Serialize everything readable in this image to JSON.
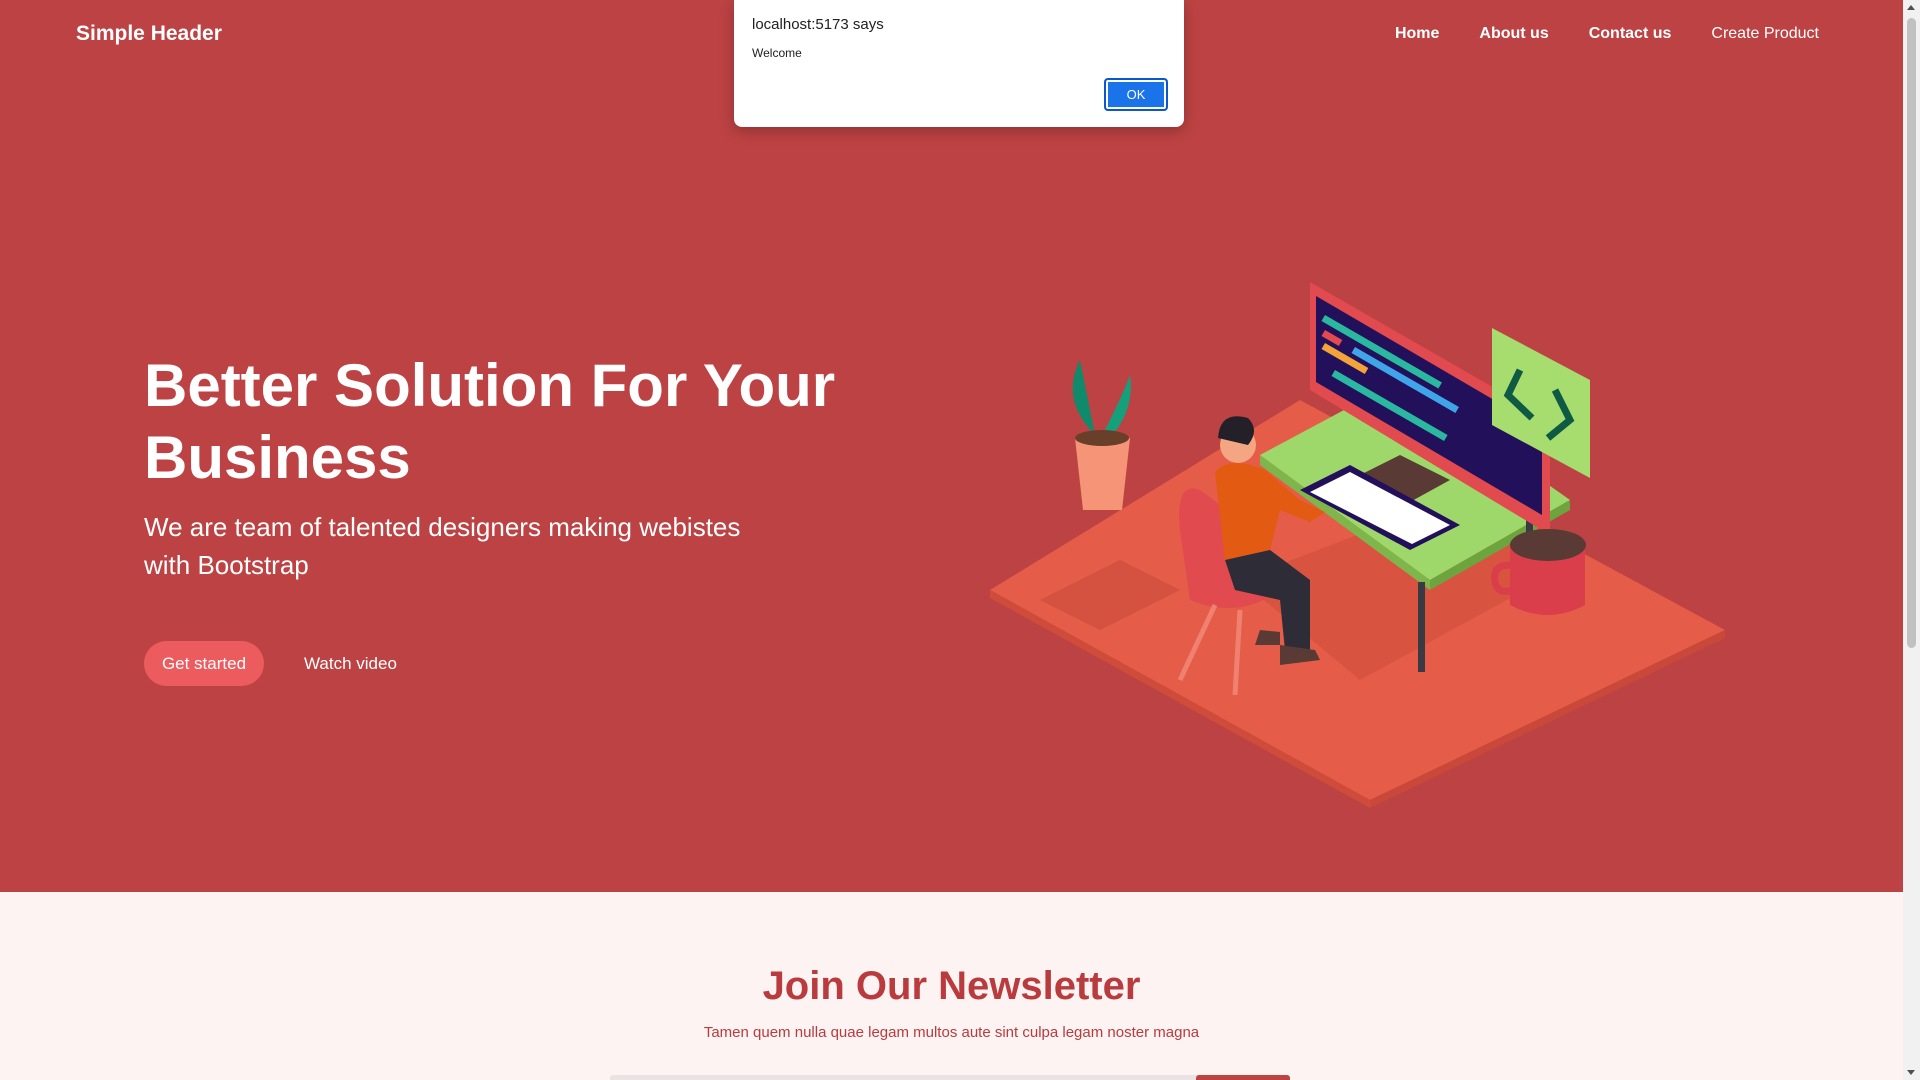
{
  "header": {
    "brand": "Simple Header",
    "nav": [
      {
        "label": "Home"
      },
      {
        "label": "About us"
      },
      {
        "label": "Contact us"
      },
      {
        "label": "Create Product"
      }
    ]
  },
  "hero": {
    "title": "Better Solution For Your Business",
    "subtitle": "We are team of talented designers making webistes with Bootstrap",
    "primary_button": "Get started",
    "secondary_button": "Watch video",
    "illustration_icon": "developer-at-desk-illustration"
  },
  "newsletter": {
    "title": "Join Our Newsletter",
    "subtitle": "Tamen quem nulla quae legam multos aute sint culpa legam noster magna"
  },
  "dialog": {
    "title": "localhost:5173 says",
    "message": "Welcome",
    "ok_label": "OK"
  },
  "colors": {
    "hero_bg": "#bd4243",
    "accent": "#ec5b5e",
    "newsletter_bg": "#fdf3f2",
    "dialog_button": "#1a73e8"
  }
}
